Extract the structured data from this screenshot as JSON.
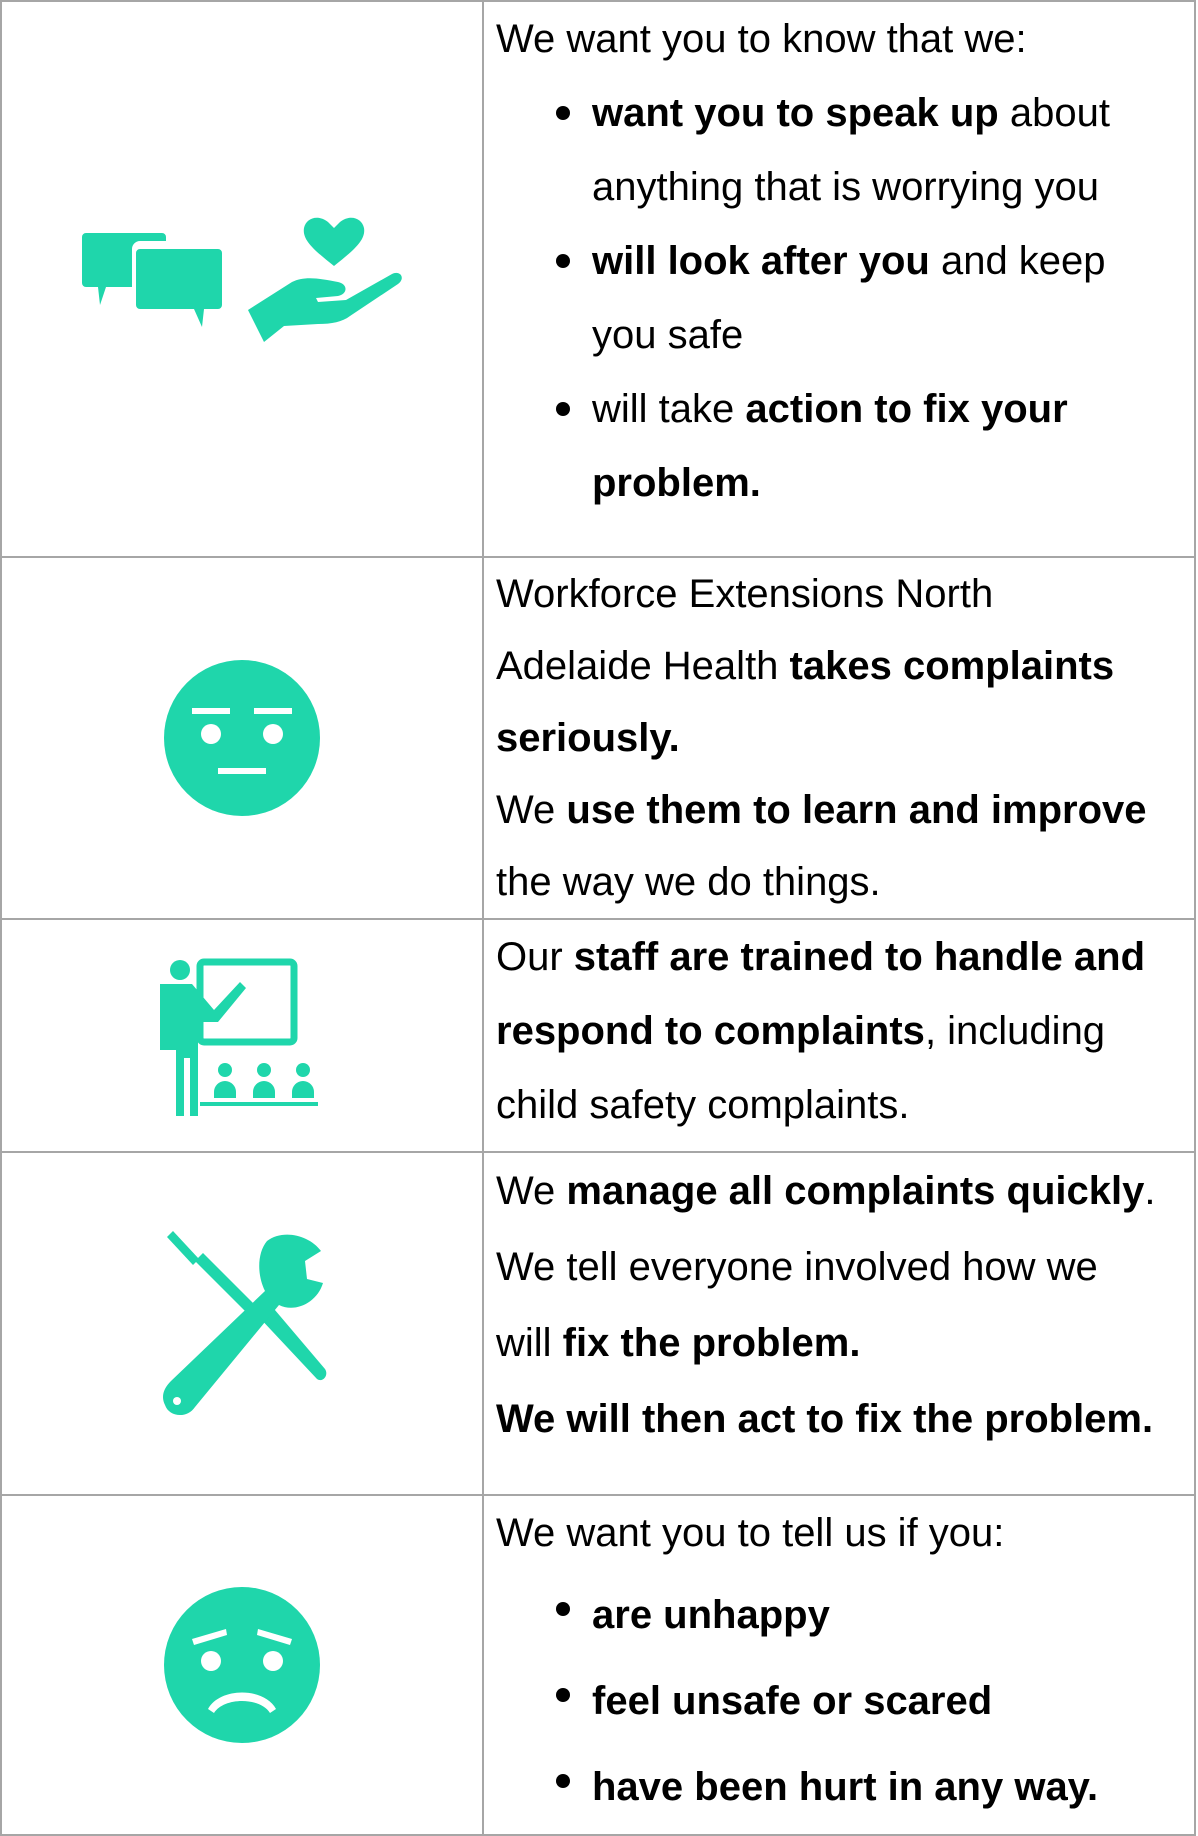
{
  "colors": {
    "icon": "#1fd6ab",
    "border": "#a6a6a6",
    "text": "#000000"
  },
  "rows": [
    {
      "icons": [
        "speech-bubbles-icon",
        "hand-heart-icon"
      ],
      "intro": "We want you to know that we:",
      "bullets": [
        {
          "b": "want you to speak up",
          "t1": " about",
          "t2": "anything that is worrying you"
        },
        {
          "b": "will look after you",
          "t1": " and keep",
          "t2": "you safe"
        },
        {
          "pre": "will take ",
          "b": "action to fix your",
          "b2": "problem."
        }
      ]
    },
    {
      "icons": [
        "neutral-face-icon"
      ],
      "line1": "Workforce Extensions  North",
      "line2_pre": "Adelaide Health ",
      "line2_b": "takes complaints",
      "line3_b": "seriously.",
      "line4_pre": "We ",
      "line4_b": "use them to learn and improve",
      "line5": "the way we do things."
    },
    {
      "icons": [
        "teacher-presentation-icon"
      ],
      "line1_pre": "Our ",
      "line1_b": "staff are trained to handle and",
      "line2_b": "respond to complaints",
      "line2_post": ", including",
      "line3": "child safety complaints."
    },
    {
      "icons": [
        "tools-screwdriver-wrench-icon"
      ],
      "line1_pre": "We ",
      "line1_b": "manage all complaints quickly",
      "line1_post": ".",
      "line2": "We tell everyone involved how we",
      "line3_pre": "will ",
      "line3_b": "fix the problem.",
      "line4_b": "We will then act to fix the problem."
    },
    {
      "icons": [
        "worried-face-icon"
      ],
      "intro": "We want you to tell us if you:",
      "bullets": [
        "are unhappy",
        "feel unsafe or scared",
        "have been hurt in any way."
      ]
    }
  ]
}
